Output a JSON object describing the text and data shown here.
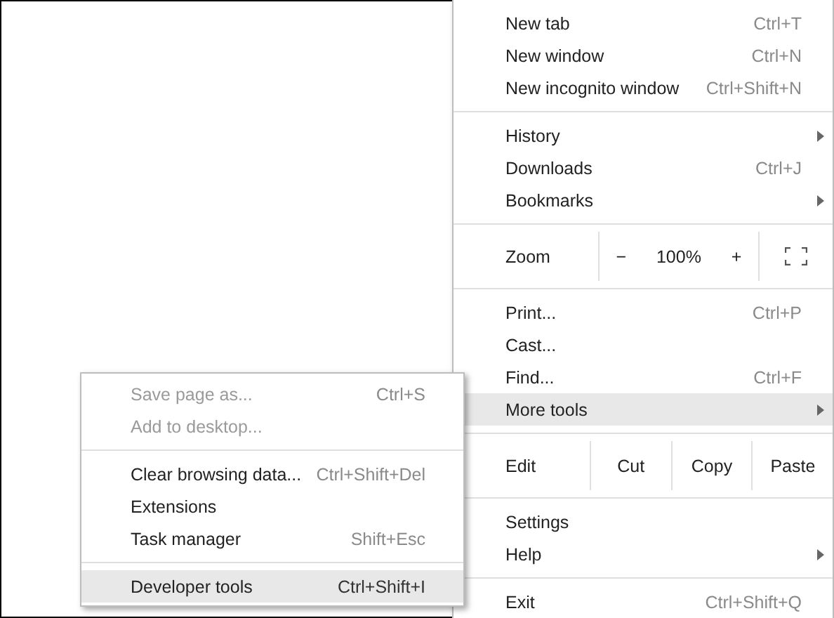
{
  "main_menu": {
    "sections": [
      {
        "kind": "items",
        "items": [
          {
            "label": "New tab",
            "shortcut": "Ctrl+T",
            "has_submenu": false,
            "selected": false,
            "disabled": false
          },
          {
            "label": "New window",
            "shortcut": "Ctrl+N",
            "has_submenu": false,
            "selected": false,
            "disabled": false
          },
          {
            "label": "New incognito window",
            "shortcut": "Ctrl+Shift+N",
            "has_submenu": false,
            "selected": false,
            "disabled": false
          }
        ]
      },
      {
        "kind": "items",
        "items": [
          {
            "label": "History",
            "has_submenu": true,
            "selected": false,
            "disabled": false
          },
          {
            "label": "Downloads",
            "shortcut": "Ctrl+J",
            "has_submenu": false,
            "selected": false,
            "disabled": false
          },
          {
            "label": "Bookmarks",
            "has_submenu": true,
            "selected": false,
            "disabled": false
          }
        ]
      },
      {
        "kind": "zoom",
        "label": "Zoom",
        "minus": "−",
        "level_text": "100%",
        "plus": "+"
      },
      {
        "kind": "items",
        "items": [
          {
            "label": "Print...",
            "shortcut": "Ctrl+P",
            "has_submenu": false,
            "selected": false,
            "disabled": false
          },
          {
            "label": "Cast...",
            "has_submenu": false,
            "selected": false,
            "disabled": false
          },
          {
            "label": "Find...",
            "shortcut": "Ctrl+F",
            "has_submenu": false,
            "selected": false,
            "disabled": false
          },
          {
            "label": "More tools",
            "has_submenu": true,
            "selected": true,
            "disabled": false
          }
        ]
      },
      {
        "kind": "edit",
        "label": "Edit",
        "buttons": [
          "Cut",
          "Copy",
          "Paste"
        ]
      },
      {
        "kind": "items",
        "items": [
          {
            "label": "Settings",
            "has_submenu": false,
            "selected": false,
            "disabled": false
          },
          {
            "label": "Help",
            "has_submenu": true,
            "selected": false,
            "disabled": false
          }
        ]
      },
      {
        "kind": "items",
        "items": [
          {
            "label": "Exit",
            "shortcut": "Ctrl+Shift+Q",
            "has_submenu": false,
            "selected": false,
            "disabled": false
          }
        ]
      }
    ]
  },
  "more_tools_submenu": {
    "sections": [
      {
        "kind": "items",
        "items": [
          {
            "label": "Save page as...",
            "shortcut": "Ctrl+S",
            "has_submenu": false,
            "selected": false,
            "disabled": true
          },
          {
            "label": "Add to desktop...",
            "has_submenu": false,
            "selected": false,
            "disabled": true
          }
        ]
      },
      {
        "kind": "items",
        "items": [
          {
            "label": "Clear browsing data...",
            "shortcut": "Ctrl+Shift+Del",
            "has_submenu": false,
            "selected": false,
            "disabled": false
          },
          {
            "label": "Extensions",
            "has_submenu": false,
            "selected": false,
            "disabled": false
          },
          {
            "label": "Task manager",
            "shortcut": "Shift+Esc",
            "has_submenu": false,
            "selected": false,
            "disabled": false
          }
        ]
      },
      {
        "kind": "items",
        "items": [
          {
            "label": "Developer tools",
            "shortcut": "Ctrl+Shift+I",
            "has_submenu": false,
            "selected": true,
            "disabled": false
          }
        ]
      }
    ]
  }
}
